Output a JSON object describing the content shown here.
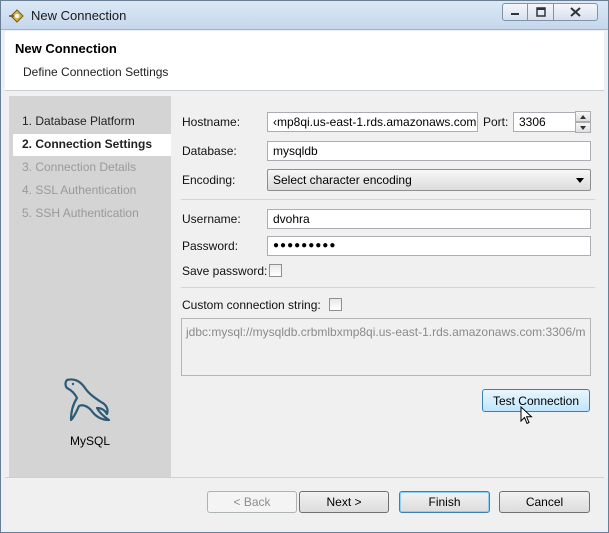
{
  "window": {
    "title": "New Connection"
  },
  "header": {
    "title": "New Connection",
    "subtitle": "Define Connection Settings"
  },
  "steps": [
    {
      "label": "1. Database Platform",
      "state": "done"
    },
    {
      "label": "2. Connection Settings",
      "state": "active"
    },
    {
      "label": "3. Connection Details",
      "state": "disabled"
    },
    {
      "label": "4. SSL Authentication",
      "state": "disabled"
    },
    {
      "label": "5. SSH Authentication",
      "state": "disabled"
    }
  ],
  "platform": {
    "name": "MySQL",
    "icon": "mysql-dolphin-icon"
  },
  "form": {
    "hostname_label": "Hostname:",
    "hostname_value": "‹mp8qi.us-east-1.rds.amazonaws.com",
    "port_label": "Port:",
    "port_value": "3306",
    "database_label": "Database:",
    "database_value": "mysqldb",
    "encoding_label": "Encoding:",
    "encoding_value": "Select character encoding",
    "username_label": "Username:",
    "username_value": "dvohra",
    "password_label": "Password:",
    "password_value": "●●●●●●●●●",
    "save_password_label": "Save password:",
    "save_password_checked": false,
    "custom_string_label": "Custom connection string:",
    "custom_string_checked": false,
    "custom_string_value": "jdbc:mysql://mysqldb.crbmlbxmp8qi.us-east-1.rds.amazonaws.com:3306/m",
    "test_connection_label": "Test Connection"
  },
  "footer": {
    "back_label": "< Back",
    "next_label": "Next >",
    "finish_label": "Finish",
    "cancel_label": "Cancel"
  },
  "colors": {
    "steps_panel": "#d4d4d4",
    "active_step_bg": "#ffffff",
    "button_hover": "#bee6fd",
    "default_button_border": "#3c7fb1"
  }
}
